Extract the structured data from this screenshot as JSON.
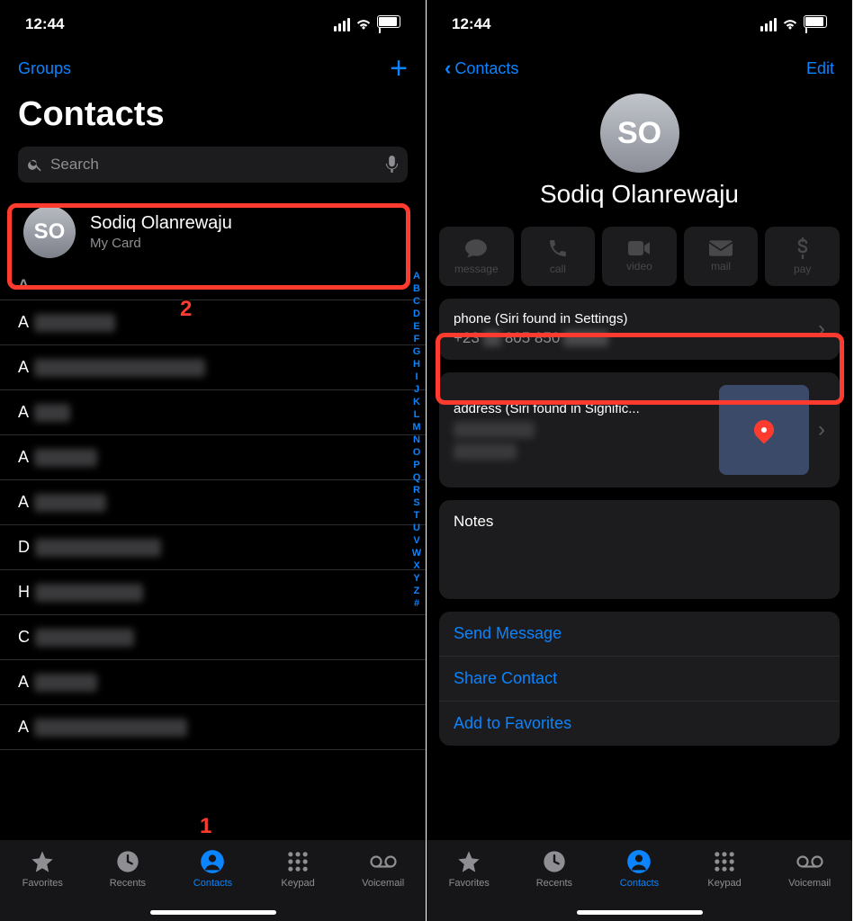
{
  "status": {
    "time": "12:44"
  },
  "left": {
    "groups_label": "Groups",
    "title": "Contacts",
    "search": {
      "placeholder": "Search"
    },
    "mycard": {
      "initials": "SO",
      "name": "Sodiq Olanrewaju",
      "sub": "My Card"
    },
    "section_a": "A",
    "rows": [
      "A",
      "A",
      "A",
      "A",
      "A",
      "D",
      "H",
      "C",
      "A",
      "A"
    ],
    "index": [
      "A",
      "B",
      "C",
      "D",
      "E",
      "F",
      "G",
      "H",
      "I",
      "J",
      "K",
      "L",
      "M",
      "N",
      "O",
      "P",
      "Q",
      "R",
      "S",
      "T",
      "U",
      "V",
      "W",
      "X",
      "Y",
      "Z",
      "#"
    ]
  },
  "right": {
    "back_label": "Contacts",
    "edit_label": "Edit",
    "avatar_initials": "SO",
    "contact_name": "Sodiq Olanrewaju",
    "actions": {
      "message": "message",
      "call": "call",
      "video": "video",
      "mail": "mail",
      "pay": "pay"
    },
    "phone": {
      "label": "phone (Siri found in Settings)",
      "prefix": "+23",
      "mid": " 805 850 "
    },
    "address": {
      "label": "address (Siri found in Signific..."
    },
    "notes_label": "Notes",
    "links": {
      "send": "Send Message",
      "share": "Share Contact",
      "fav": "Add to Favorites"
    }
  },
  "tabs": {
    "favorites": "Favorites",
    "recents": "Recents",
    "contacts": "Contacts",
    "keypad": "Keypad",
    "voicemail": "Voicemail"
  },
  "annotations": {
    "num1": "1",
    "num2": "2"
  }
}
